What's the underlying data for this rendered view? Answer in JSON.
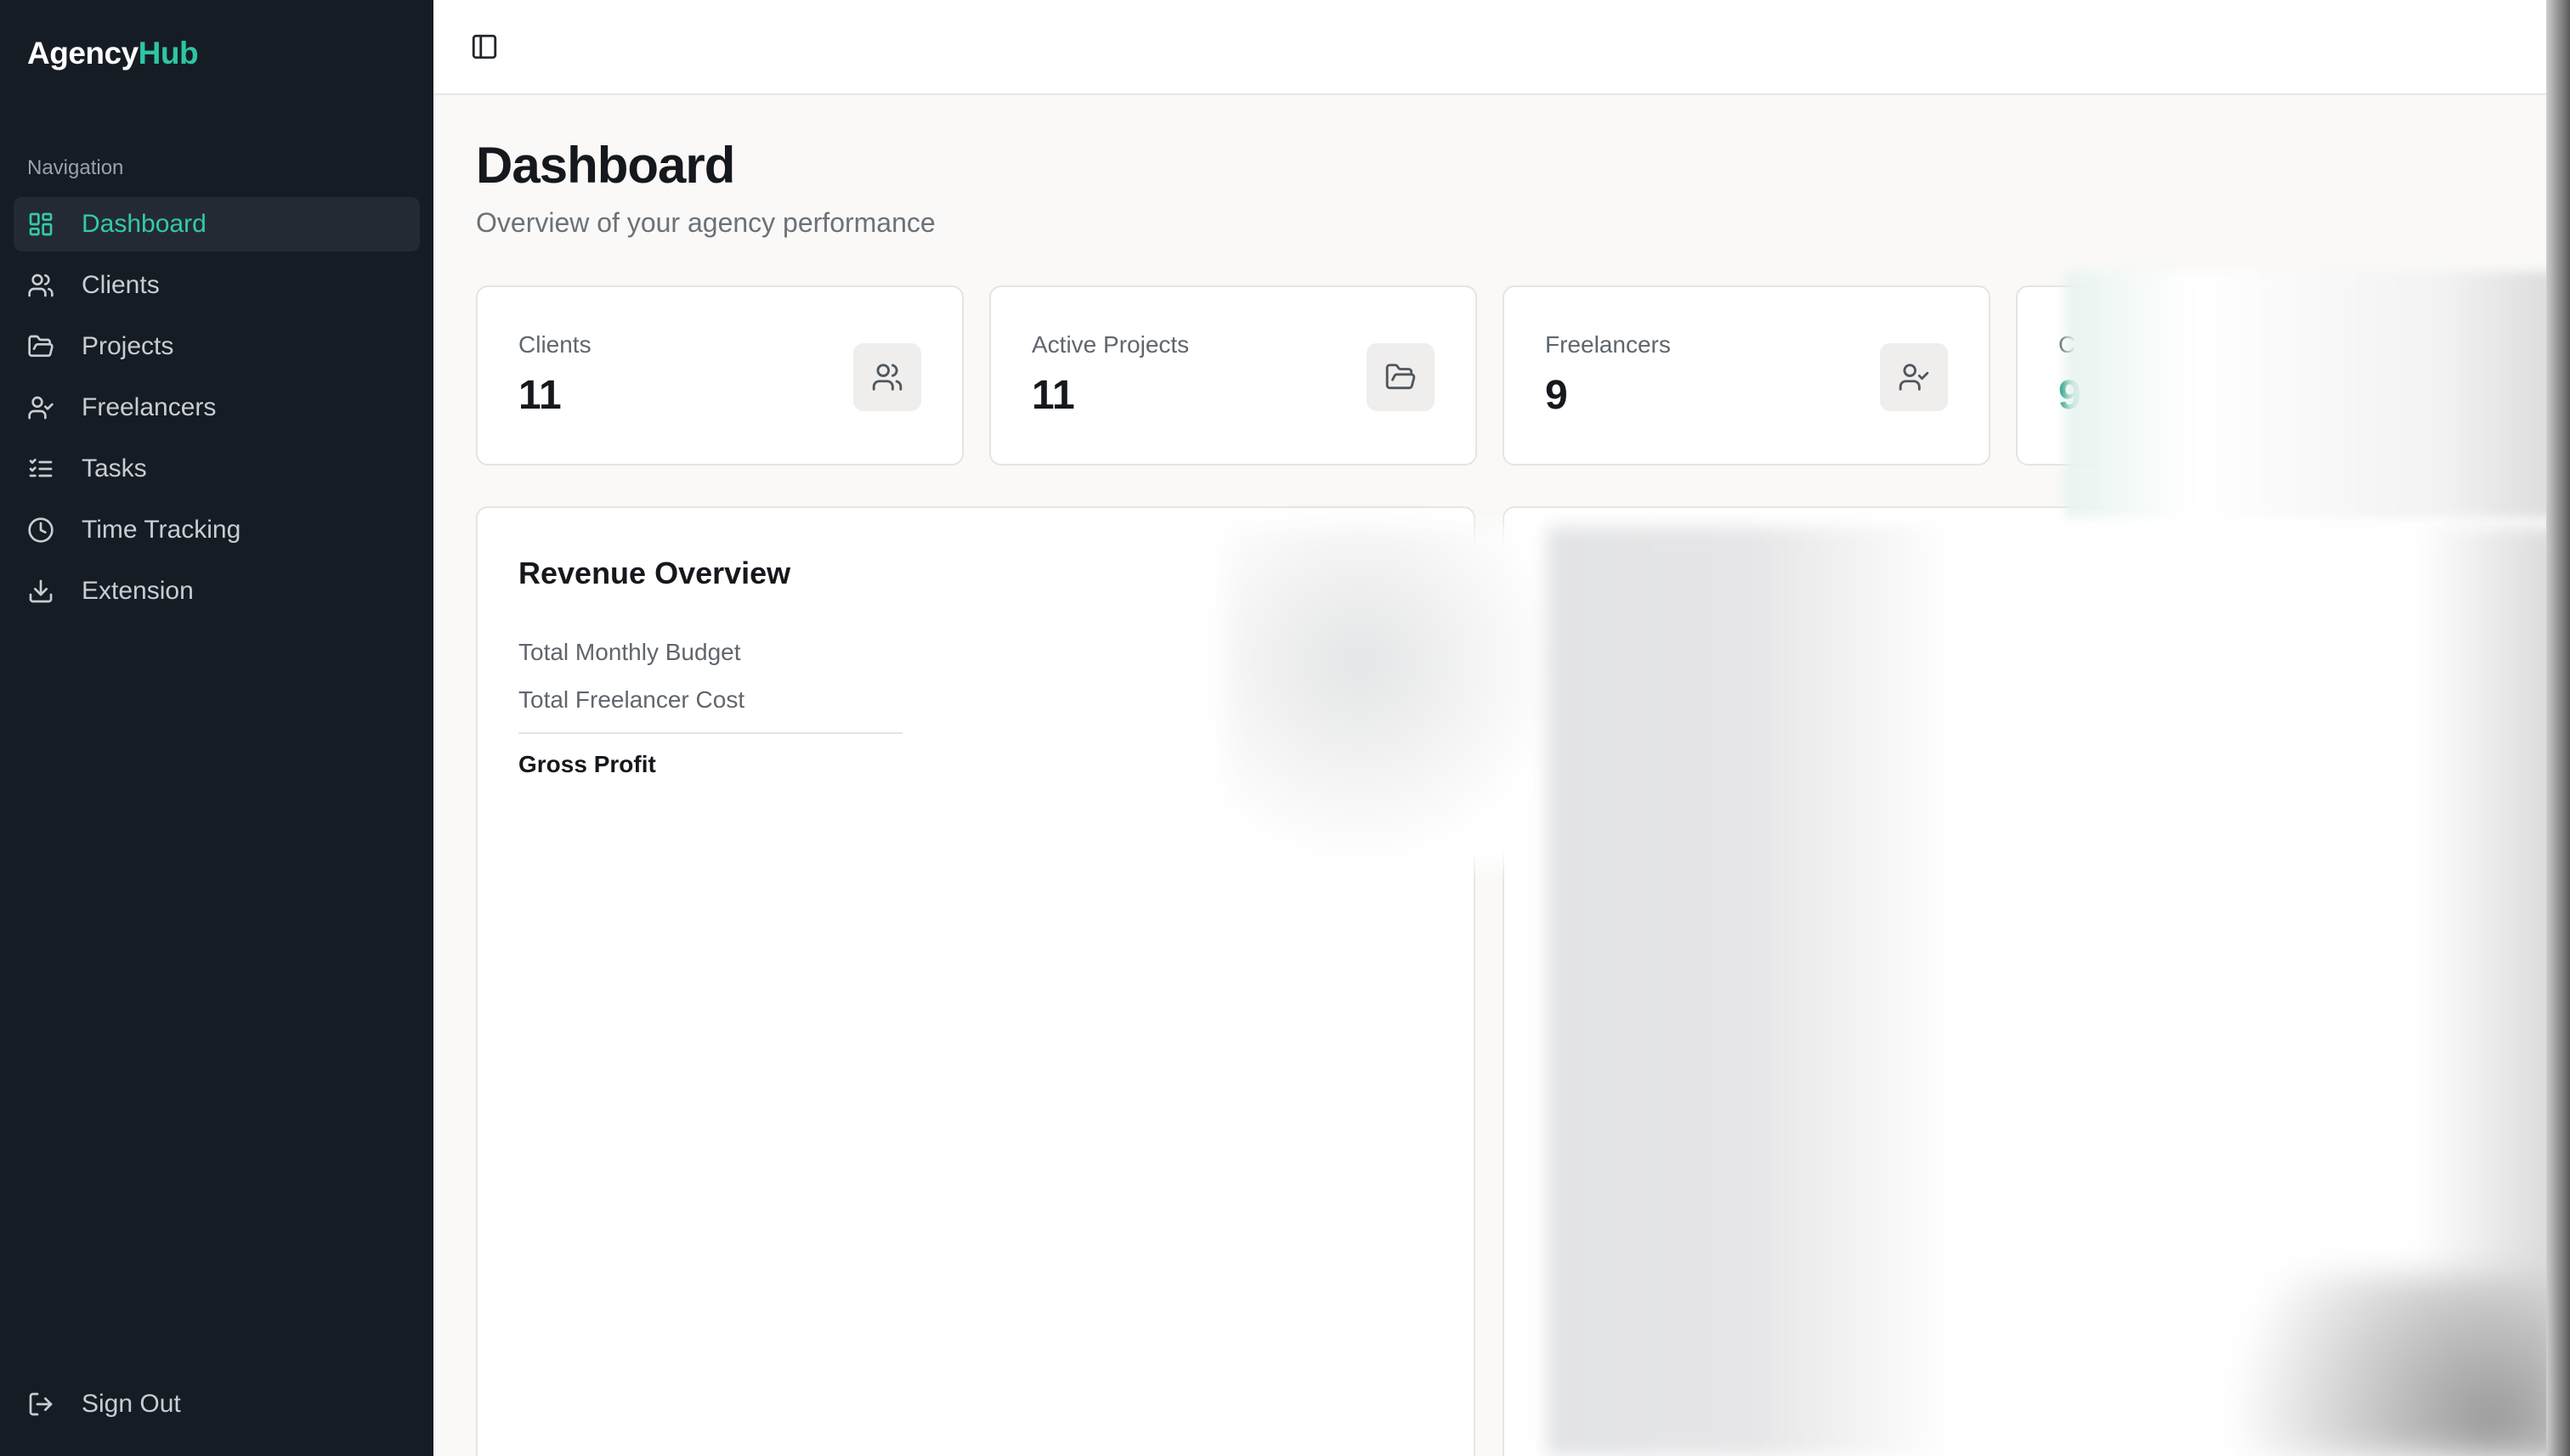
{
  "brand": {
    "name_part1": "Agency",
    "name_part2": "Hub",
    "accent_color": "#2cc6a5"
  },
  "sidebar": {
    "heading": "Navigation",
    "items": [
      {
        "label": "Dashboard",
        "icon": "layout-grid-icon",
        "active": true
      },
      {
        "label": "Clients",
        "icon": "users-icon",
        "active": false
      },
      {
        "label": "Projects",
        "icon": "folder-icon",
        "active": false
      },
      {
        "label": "Freelancers",
        "icon": "user-check-icon",
        "active": false
      },
      {
        "label": "Tasks",
        "icon": "list-checks-icon",
        "active": false
      },
      {
        "label": "Time Tracking",
        "icon": "clock-icon",
        "active": false
      },
      {
        "label": "Extension",
        "icon": "download-icon",
        "active": false
      }
    ],
    "sign_out": {
      "label": "Sign Out",
      "icon": "log-out-icon"
    }
  },
  "header": {
    "toggle_icon": "panel-left-icon"
  },
  "page": {
    "title": "Dashboard",
    "subtitle": "Overview of your agency performance"
  },
  "stats": [
    {
      "label": "Clients",
      "value": "11",
      "icon": "users-icon"
    },
    {
      "label": "Active Projects",
      "value": "11",
      "icon": "folder-open-icon"
    },
    {
      "label": "Freelancers",
      "value": "9",
      "icon": "user-check-icon"
    },
    {
      "label": "C",
      "value": "9",
      "icon": ""
    }
  ],
  "revenue": {
    "title": "Revenue Overview",
    "rows": [
      "Total Monthly Budget",
      "Total Freelancer Cost"
    ],
    "total_label": "Gross Profit"
  }
}
